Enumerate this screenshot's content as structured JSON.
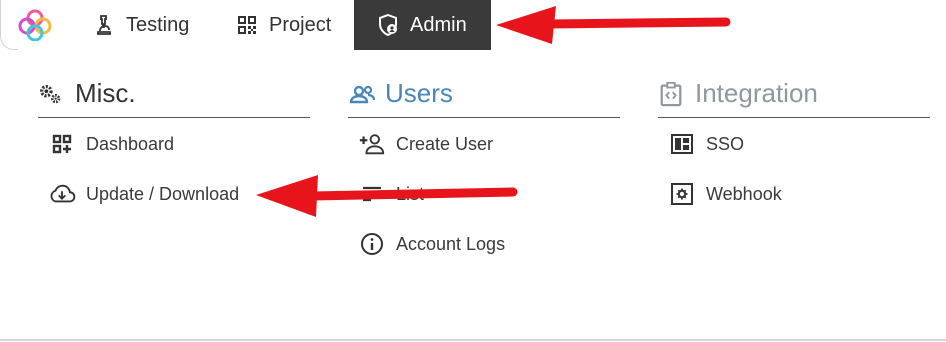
{
  "nav": {
    "tabs": [
      {
        "label": "Testing",
        "icon": "microscope-icon"
      },
      {
        "label": "Project",
        "icon": "qr-code-icon"
      },
      {
        "label": "Admin",
        "icon": "shield-user-icon",
        "active": true
      }
    ]
  },
  "menu": {
    "misc": {
      "title": "Misc.",
      "icon": "gears-icon",
      "items": [
        {
          "label": "Dashboard",
          "icon": "dashboard-plus-icon"
        },
        {
          "label": "Update / Download",
          "icon": "cloud-download-icon"
        }
      ]
    },
    "users": {
      "title": "Users",
      "icon": "users-icon",
      "items": [
        {
          "label": "Create User",
          "icon": "add-user-icon"
        },
        {
          "label": "List",
          "icon": "list-icon"
        },
        {
          "label": "Account Logs",
          "icon": "info-icon"
        }
      ]
    },
    "integration": {
      "title": "Integration",
      "icon": "integration-icon",
      "items": [
        {
          "label": "SSO",
          "icon": "sso-icon"
        },
        {
          "label": "Webhook",
          "icon": "webhook-icon"
        }
      ]
    }
  },
  "colors": {
    "active_tab_bg": "#3a3a3a",
    "users_heading": "#4a87b8",
    "integration_heading": "#8d999c",
    "annotation_arrow": "#e8141b"
  }
}
